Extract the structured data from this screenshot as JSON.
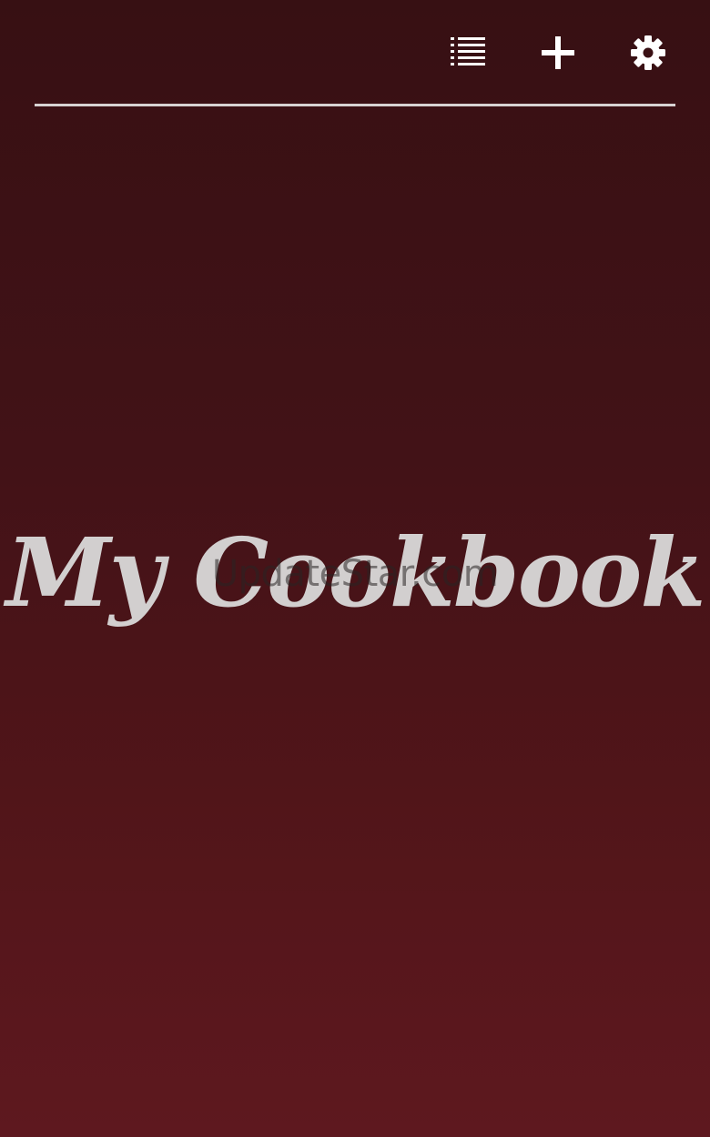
{
  "app": {
    "title": "My Cookbook",
    "watermark": "UpdateStar.com"
  },
  "toolbar": {
    "buttons": [
      {
        "id": "list",
        "icon": "list-icon"
      },
      {
        "id": "add",
        "icon": "plus-icon"
      },
      {
        "id": "settings",
        "icon": "gear-icon"
      }
    ]
  },
  "colors": {
    "background_top": "#371013",
    "background_bottom": "#5e181f",
    "icon": "#ffffff",
    "title_text": "#d2cfcf",
    "divider": "#d8d2d2"
  }
}
